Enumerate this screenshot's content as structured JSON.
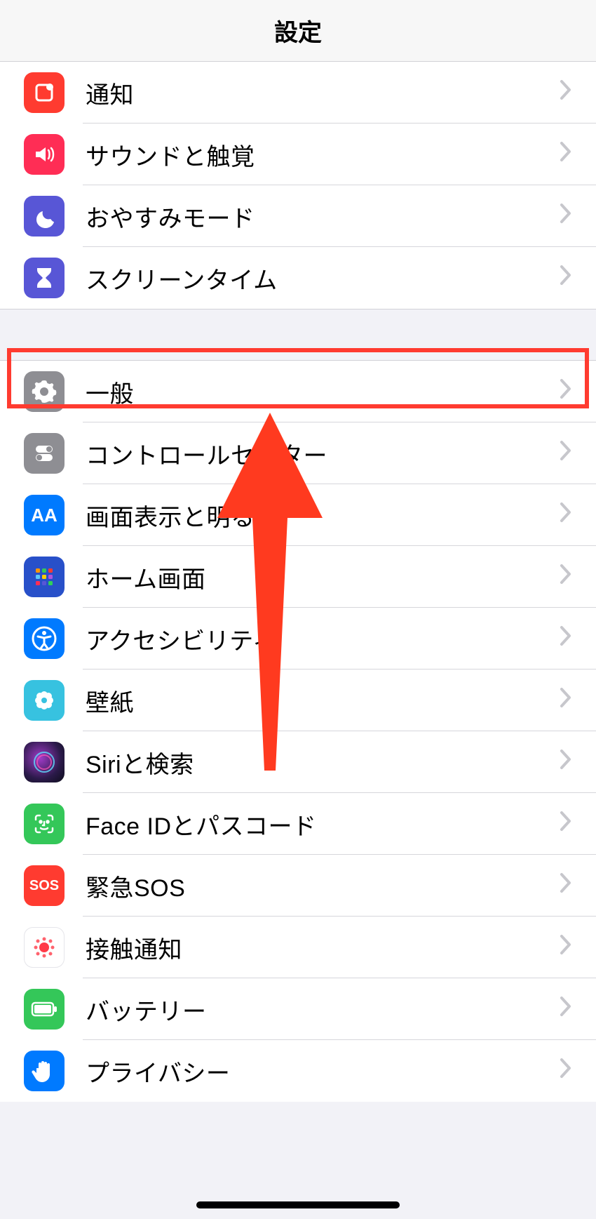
{
  "header": {
    "title": "設定"
  },
  "groups": [
    {
      "rows": [
        {
          "id": "notifications",
          "label": "通知",
          "icon": "notifications-icon",
          "bg": "#ff3b30"
        },
        {
          "id": "sounds",
          "label": "サウンドと触覚",
          "icon": "speaker-icon",
          "bg": "#ff2d55"
        },
        {
          "id": "dnd",
          "label": "おやすみモード",
          "icon": "moon-icon",
          "bg": "#5856d6"
        },
        {
          "id": "screen-time",
          "label": "スクリーンタイム",
          "icon": "hourglass-icon",
          "bg": "#5856d6"
        }
      ]
    },
    {
      "rows": [
        {
          "id": "general",
          "label": "一般",
          "icon": "gear-icon",
          "bg": "#8e8e93"
        },
        {
          "id": "control-center",
          "label": "コントロールセンター",
          "icon": "toggles-icon",
          "bg": "#8e8e93"
        },
        {
          "id": "display",
          "label": "画面表示と明るさ",
          "icon": "text-size-icon",
          "bg": "#007aff",
          "text": "AA"
        },
        {
          "id": "home-screen",
          "label": "ホーム画面",
          "icon": "grid-icon",
          "bg": "#2850c9"
        },
        {
          "id": "accessibility",
          "label": "アクセシビリティ",
          "icon": "accessibility-icon",
          "bg": "#007aff"
        },
        {
          "id": "wallpaper",
          "label": "壁紙",
          "icon": "flower-icon",
          "bg": "#37c2e0"
        },
        {
          "id": "siri",
          "label": "Siriと検索",
          "icon": "siri-icon",
          "bg": "#1b1b2b"
        },
        {
          "id": "faceid",
          "label": "Face IDとパスコード",
          "icon": "face-icon",
          "bg": "#34c759"
        },
        {
          "id": "sos",
          "label": "緊急SOS",
          "icon": "sos-icon",
          "bg": "#ff3b30",
          "text": "SOS"
        },
        {
          "id": "exposure",
          "label": "接触通知",
          "icon": "exposure-icon",
          "bg": "#ffffff"
        },
        {
          "id": "battery",
          "label": "バッテリー",
          "icon": "battery-icon",
          "bg": "#34c759"
        },
        {
          "id": "privacy",
          "label": "プライバシー",
          "icon": "hand-icon",
          "bg": "#007aff"
        }
      ]
    }
  ],
  "annotation": {
    "highlighted_row": "general",
    "arrow_color": "#ff3a1f"
  }
}
